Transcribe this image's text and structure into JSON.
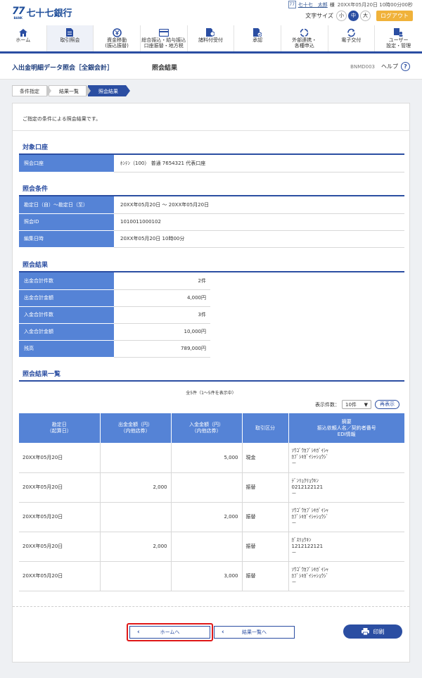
{
  "header": {
    "logo_mark": "77",
    "logo_bank": "BANK",
    "logo_name": "七十七銀行",
    "user_badge": "77",
    "user_name": "七十七　太郎",
    "user_suffix": "様",
    "last_login": "20XX年05月20日 10時00分00秒",
    "font_size_label": "文字サイズ",
    "font_small": "小",
    "font_medium": "中",
    "font_large": "大",
    "logout": "ログアウト"
  },
  "nav": [
    {
      "label": "ホーム",
      "icon": "home-icon"
    },
    {
      "label": "取引照会",
      "icon": "document-icon"
    },
    {
      "label": "資金移動\n(振込振替)",
      "icon": "yen-transfer-icon"
    },
    {
      "label": "総合振込・給与振込\n口座振替・地方税",
      "icon": "card-icon"
    },
    {
      "label": "諸料付受付",
      "icon": "person-doc-icon"
    },
    {
      "label": "承認",
      "icon": "approval-icon"
    },
    {
      "label": "外部連携・\n各種申込",
      "icon": "link-icon"
    },
    {
      "label": "電子交付",
      "icon": "cycle-icon"
    },
    {
      "label": "ユーザー\n設定・管理",
      "icon": "users-icon"
    }
  ],
  "page": {
    "title": "入出金明細データ照会［全銀会計］",
    "subtitle": "照会結果",
    "screen_id": "BNMD003",
    "help": "ヘルプ",
    "help_icon": "?"
  },
  "breadcrumbs": [
    "条件指定",
    "結果一覧",
    "照会結果"
  ],
  "intro": "ご指定の条件による照会結果です。",
  "target_account": {
    "title": "対象口座",
    "rows": [
      {
        "label": "照会口座",
        "value": "ﾎﾝﾃﾝ（100） 普通 7654321 代表口座"
      }
    ]
  },
  "conditions": {
    "title": "照会条件",
    "rows": [
      {
        "label": "勘定日（自）～勘定日（至）",
        "value": "20XX年05月20日 ～ 20XX年05月20日"
      },
      {
        "label": "照会ID",
        "value": "1010011000102"
      },
      {
        "label": "編集日時",
        "value": "20XX年05月20日 10時00分"
      }
    ]
  },
  "summary": {
    "title": "照会結果",
    "rows": [
      {
        "label": "出金合計件数",
        "value": "2件"
      },
      {
        "label": "出金合計金額",
        "value": "4,000円"
      },
      {
        "label": "入金合計件数",
        "value": "3件"
      },
      {
        "label": "入金合計金額",
        "value": "10,000円"
      },
      {
        "label": "残高",
        "value": "789,000円"
      }
    ]
  },
  "results": {
    "title": "照会結果一覧",
    "count_text": "全5件（1～5件を表示中）",
    "page_size_label": "表示件数：",
    "page_size_value": "10件",
    "redisplay": "再表示",
    "headers": [
      "勘定日\n（起算日）",
      "出金金額（円）\n（内他店券）",
      "入金金額（円）\n（内他店券）",
      "取引区分",
      "摘要\n振込依頼人名／契約者番号\nEDI情報"
    ],
    "rows": [
      {
        "date": "20XX年05月20日",
        "withdrawal": "",
        "deposit": "5,000",
        "type": "現金",
        "memo1": "ｿｳｺﾞｳｶﾌﾞｼｷｶﾞｲｼｬ",
        "memo2": "ｶﾌﾞｼｷｶﾞｲｼｬｼｮｳｼﾞ",
        "memo3": "－"
      },
      {
        "date": "20XX年05月20日",
        "withdrawal": "2,000",
        "deposit": "",
        "type": "振替",
        "memo1": "ﾃﾞﾝﾘｮｸﾘｮｳｷﾝ",
        "memo2": "0212122121",
        "memo3": "－"
      },
      {
        "date": "20XX年05月20日",
        "withdrawal": "",
        "deposit": "2,000",
        "type": "振替",
        "memo1": "ｿｳｺﾞｳｶﾌﾞｼｷｶﾞｲｼｬ",
        "memo2": "ｶﾌﾞｼｷｶﾞｲｼｬｼｮｳｼﾞ",
        "memo3": "－"
      },
      {
        "date": "20XX年05月20日",
        "withdrawal": "2,000",
        "deposit": "",
        "type": "振替",
        "memo1": "ｶﾞｽﾘｮｳｷﾝ",
        "memo2": "1212122121",
        "memo3": "－"
      },
      {
        "date": "20XX年05月20日",
        "withdrawal": "",
        "deposit": "3,000",
        "type": "振替",
        "memo1": "ｿｳｺﾞｳｶﾌﾞｼｷｶﾞｲｼｬ",
        "memo2": "ｶﾌﾞｼｷｶﾞｲｼｬｼｮｳｼﾞ",
        "memo3": "－"
      }
    ]
  },
  "buttons": {
    "home": "ホームへ",
    "results_list": "結果一覧へ",
    "print": "印刷"
  },
  "colors": {
    "brand": "#2b4ea2",
    "label_bg": "#5583d6",
    "logout": "#f0b23a",
    "highlight": "#e01818"
  }
}
